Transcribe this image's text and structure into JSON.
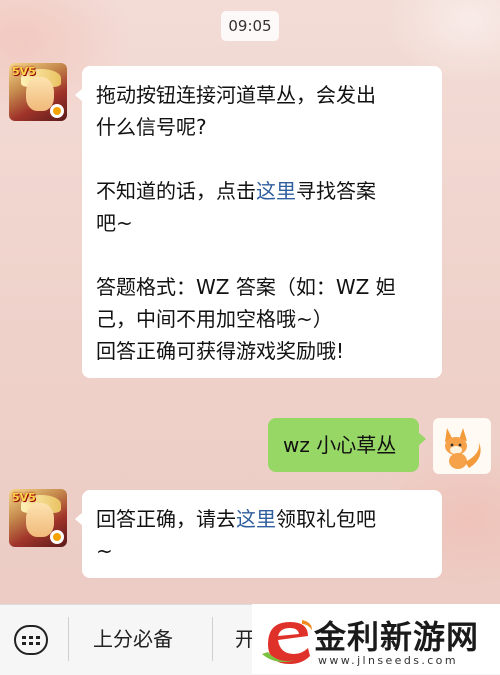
{
  "status": {
    "time": "09:05"
  },
  "messages": [
    {
      "lines": [
        "拖动按钮连接河道草丛，会发出",
        "什么信号呢?",
        "",
        [
          "不知道的话，点击",
          "这里",
          "寻找答案"
        ],
        "吧~",
        "",
        "答题格式：WZ 答案（如：WZ 妲",
        "己，中间不用加空格哦~）",
        "回答正确可获得游戏奖励哦!"
      ]
    },
    {
      "text": "wz 小心草丛"
    },
    {
      "line1_prefix": "回答正确，请去",
      "line1_link": "这里",
      "line1_suffix": "领取礼包吧",
      "line2": "~"
    }
  ],
  "avatars": {
    "game_logo": "5V5"
  },
  "bottom_menu": {
    "keyboard_icon": "keyboard-icon",
    "item1": "上分必备",
    "item2_partial": "开"
  },
  "watermark": {
    "brand": "金利新游网",
    "url": "www.jlnseeds.com"
  },
  "colors": {
    "link": "#2f5e9e",
    "my_bubble": "#96d766",
    "watermark_orange": "#f08a1e",
    "watermark_red": "#e0302a",
    "watermark_green": "#7cc242"
  }
}
